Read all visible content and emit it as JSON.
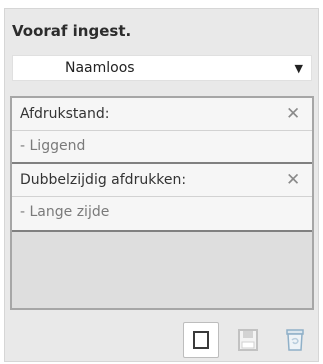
{
  "panel": {
    "title": "Vooraf ingest.",
    "preset": {
      "selected": "Naamloos",
      "caret_icon": "chevron-down-icon"
    },
    "settings": [
      {
        "label": "Afdrukstand:",
        "value": "- Liggend",
        "remove_icon": "close-icon"
      },
      {
        "label": "Dubbelzijdig afdrukken:",
        "value": "- Lange zijde",
        "remove_icon": "close-icon"
      }
    ],
    "footer": {
      "new_icon": "new-preset-icon",
      "save_icon": "save-icon",
      "delete_icon": "delete-icon"
    }
  },
  "colors": {
    "panel_bg": "#e9e9e9",
    "list_bg": "#dedede",
    "item_bg": "#f6f6f6",
    "disabled_icon": "#c2c2c2",
    "disabled_icon_accent": "#8fb0c8"
  }
}
